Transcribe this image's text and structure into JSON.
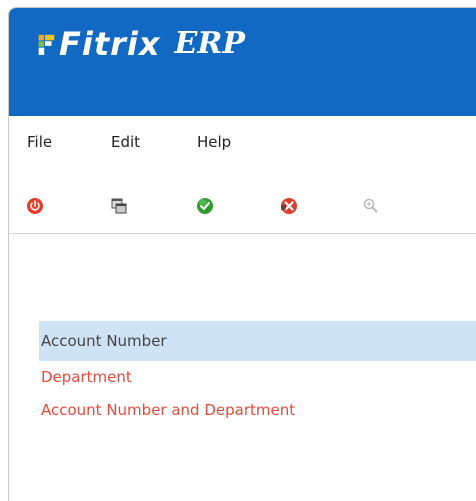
{
  "app": {
    "logo_text": "Fitrix",
    "product_text": "ERP",
    "brand_color": "#1169c4"
  },
  "menu": {
    "items": [
      {
        "label": "File"
      },
      {
        "label": "Edit"
      },
      {
        "label": "Help"
      }
    ]
  },
  "toolbar": {
    "buttons": [
      {
        "icon": "power-icon",
        "color": "#e53b2a"
      },
      {
        "icon": "copy-windows-icon",
        "color": "#4a4a4a"
      },
      {
        "icon": "accept-check-icon",
        "color": "#2e9b2e"
      },
      {
        "icon": "cancel-x-icon",
        "color": "#d8402c"
      },
      {
        "icon": "zoom-icon",
        "color": "#b9b9b9"
      }
    ]
  },
  "list": {
    "items": [
      {
        "label": "Account Number",
        "selected": true
      },
      {
        "label": "Department",
        "selected": false
      },
      {
        "label": "Account Number and Department",
        "selected": false
      }
    ],
    "selected_bg": "#cfe3f6",
    "item_color": "#e54b3c"
  }
}
